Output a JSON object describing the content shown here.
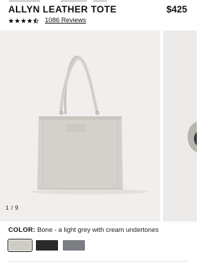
{
  "product": {
    "title": "ALLYN LEATHER TOTE",
    "price": "$425"
  },
  "rating": {
    "stars_value": 4.5,
    "stars_max": 5,
    "reviews_label": "1086 Reviews"
  },
  "gallery": {
    "counter": "1 / 9",
    "current_slide": 1,
    "total_slides": 9
  },
  "color": {
    "label": "COLOR:",
    "selected_description": "Bone - a light grey with cream undertones",
    "swatches": [
      {
        "name": "bone-swatch",
        "hex": "#cfcbc5",
        "selected": true
      },
      {
        "name": "black-swatch",
        "hex": "#2b2828",
        "selected": false
      },
      {
        "name": "grey-swatch",
        "hex": "#7b7d82",
        "selected": false
      }
    ]
  },
  "colors": {
    "text": "#111111",
    "image_background": "#f1efed",
    "tote": "#d3d0cb"
  }
}
